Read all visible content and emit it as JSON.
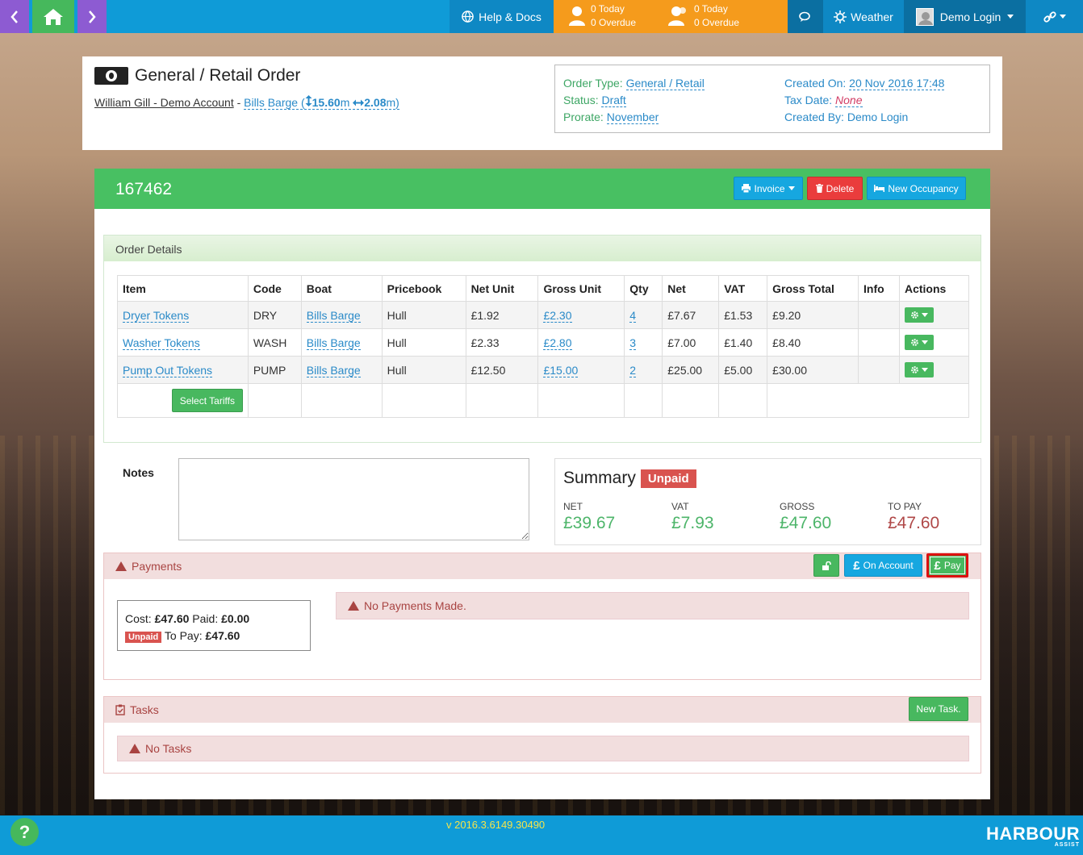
{
  "nav": {
    "help_label": "Help & Docs",
    "stats1": {
      "today": "0 Today",
      "overdue": "0 Overdue"
    },
    "stats2": {
      "today": "0 Today",
      "overdue": "0 Overdue"
    },
    "weather_label": "Weather",
    "user_label": "Demo Login"
  },
  "order": {
    "title": "General / Retail Order",
    "account": "William Gill - Demo Account",
    "separator": "-",
    "boat": "Bills Barge",
    "length": "15.60",
    "length_unit": "m",
    "beam": "2.08",
    "beam_unit": "m",
    "paren_open": "(",
    "paren_close": ")"
  },
  "meta": {
    "order_type_label": "Order Type:",
    "order_type": "General / Retail",
    "status_label": "Status:",
    "status": "Draft",
    "prorate_label": "Prorate:",
    "prorate": "November",
    "created_on_label": "Created On:",
    "created_on": "20 Nov 2016 17:48",
    "tax_date_label": "Tax Date:",
    "tax_date": "None",
    "created_by_label": "Created By:",
    "created_by": "Demo Login"
  },
  "panel": {
    "order_number": "167462",
    "invoice_label": "Invoice",
    "delete_label": "Delete",
    "new_occupancy_label": "New Occupancy"
  },
  "order_details": {
    "heading": "Order Details",
    "columns": [
      "Item",
      "Code",
      "Boat",
      "Pricebook",
      "Net Unit",
      "Gross Unit",
      "Qty",
      "Net",
      "VAT",
      "Gross Total",
      "Info",
      "Actions"
    ],
    "rows": [
      {
        "item": "Dryer Tokens",
        "code": "DRY",
        "boat": "Bills Barge",
        "pricebook": "Hull",
        "net_unit": "£1.92",
        "gross_unit": "£2.30",
        "qty": "4",
        "net": "£7.67",
        "vat": "£1.53",
        "gross_total": "£9.20"
      },
      {
        "item": "Washer Tokens",
        "code": "WASH",
        "boat": "Bills Barge",
        "pricebook": "Hull",
        "net_unit": "£2.33",
        "gross_unit": "£2.80",
        "qty": "3",
        "net": "£7.00",
        "vat": "£1.40",
        "gross_total": "£8.40"
      },
      {
        "item": "Pump Out Tokens",
        "code": "PUMP",
        "boat": "Bills Barge",
        "pricebook": "Hull",
        "net_unit": "£12.50",
        "gross_unit": "£15.00",
        "qty": "2",
        "net": "£25.00",
        "vat": "£5.00",
        "gross_total": "£30.00"
      }
    ],
    "select_tariffs_label": "Select Tariffs"
  },
  "notes": {
    "label": "Notes",
    "value": ""
  },
  "summary": {
    "title": "Summary",
    "status": "Unpaid",
    "net_label": "NET",
    "net": "£39.67",
    "vat_label": "VAT",
    "vat": "£7.93",
    "gross_label": "GROSS",
    "gross": "£47.60",
    "topay_label": "TO PAY",
    "topay": "£47.60"
  },
  "payments": {
    "heading": "Payments",
    "on_account_label": "On Account",
    "pay_label": "Pay",
    "cost_label": "Cost:",
    "cost": "£47.60",
    "paid_label": "Paid:",
    "paid": "£0.00",
    "status": "Unpaid",
    "topay_label": "To Pay:",
    "topay": "£47.60",
    "no_payments": "No Payments Made."
  },
  "tasks": {
    "heading": "Tasks",
    "new_task_label": "New Task.",
    "no_tasks": "No Tasks"
  },
  "footer": {
    "version": "v 2016.3.6149.30490",
    "help_glyph": "?",
    "brand": "HARBOUR",
    "brand_sub": "ASSIST"
  },
  "colors": {
    "nav_blue": "#0f9bd7",
    "nav_orange": "#f59b1c",
    "nav_purple": "#8d5bd2",
    "green": "#48c062",
    "danger": "#d9534f"
  }
}
